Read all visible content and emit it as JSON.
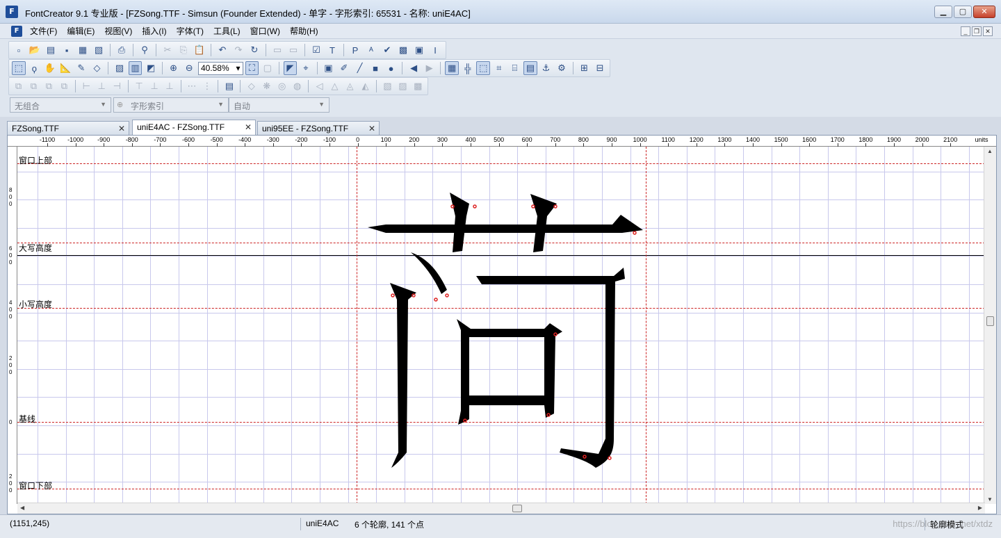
{
  "window": {
    "icon_text": "F",
    "title": "FontCreator 9.1 专业版  - [FZSong.TTF - Simsun (Founder Extended) - 单字 - 字形索引: 65531 - 名称: uniE4AC]",
    "min": "▁",
    "max": "▢",
    "close": "✕"
  },
  "menu": {
    "items": [
      "文件(F)",
      "编辑(E)",
      "视图(V)",
      "插入(I)",
      "字体(T)",
      "工具(L)",
      "窗口(W)",
      "帮助(H)"
    ],
    "mdi_min": "_",
    "mdi_restore": "❐",
    "mdi_close": "✕"
  },
  "toolbar": {
    "zoom_value": "40.58%",
    "combo_group": "无组合",
    "combo_index": "字形索引",
    "combo_mode": "自动"
  },
  "tabs": [
    {
      "label": "FZSong.TTF",
      "close": "✕"
    },
    {
      "label": "uniE4AC - FZSong.TTF",
      "close": "✕"
    },
    {
      "label": "uni95EE - FZSong.TTF",
      "close": "✕"
    }
  ],
  "ruler": {
    "ticks": [
      "-1100",
      "-1000",
      "-900",
      "-800",
      "-700",
      "-600",
      "-500",
      "-400",
      "-300",
      "-200",
      "-100",
      "0",
      "100",
      "200",
      "300",
      "400",
      "500",
      "600",
      "700",
      "800",
      "900",
      "1000",
      "1100",
      "1200",
      "1300",
      "1400",
      "1500",
      "1600",
      "1700",
      "1800",
      "1900",
      "2000",
      "2100"
    ],
    "units": "units",
    "left_labels": [
      "8",
      "0",
      "0",
      "6",
      "0",
      "0",
      "4",
      "0",
      "0",
      "2",
      "0",
      "0",
      "0",
      "2",
      "0",
      "0"
    ]
  },
  "guides": {
    "window_top": "窗口上部",
    "cap_height": "大写高度",
    "x_height": "小写高度",
    "baseline": "基线",
    "window_bottom": "窗口下部"
  },
  "status": {
    "coords": "(1151,245)",
    "glyph_name": "uniE4AC",
    "contours_points": "6 个轮廓, 141 个点",
    "mode": "轮廓模式",
    "watermark": "https://blog.csdn.net/xtdz"
  }
}
